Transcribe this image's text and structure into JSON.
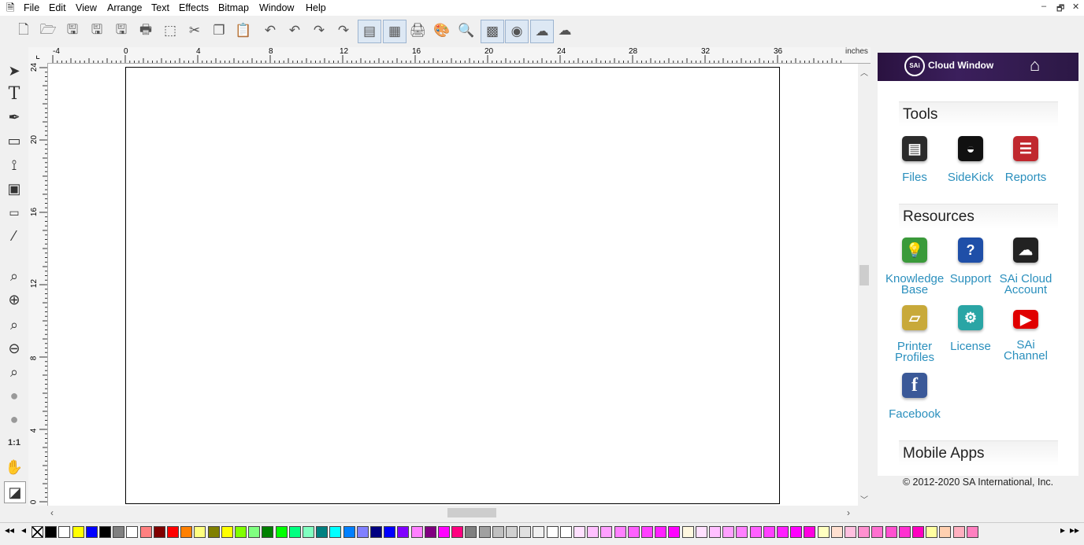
{
  "menu": [
    "File",
    "Edit",
    "View",
    "Arrange",
    "Text",
    "Effects",
    "Bitmap",
    "Window",
    "Help"
  ],
  "window_controls": [
    "–",
    "🗗",
    "✕"
  ],
  "ruler": {
    "unit": "inches",
    "h_ticks": [
      "-4",
      "0",
      "4",
      "8",
      "12",
      "16",
      "20",
      "24",
      "28",
      "32",
      "36"
    ],
    "v_ticks": [
      "24",
      "20",
      "16",
      "12",
      "8",
      "4",
      "0"
    ]
  },
  "cloud": {
    "title": "Cloud Window",
    "tools_title": "Tools",
    "tools": [
      {
        "label": "Files",
        "icon": "files-icon",
        "color": "#2b2b2b"
      },
      {
        "label": "SideKick",
        "icon": "sidekick-icon",
        "color": "#111111"
      },
      {
        "label": "Reports",
        "icon": "reports-icon",
        "color": "#c0282e"
      }
    ],
    "resources_title": "Resources",
    "resources": [
      {
        "label": "Knowledge Base",
        "icon": "knowledge-base-icon",
        "color": "#3a9a3a"
      },
      {
        "label": "Support",
        "icon": "support-icon",
        "color": "#1f4fa8"
      },
      {
        "label": "SAi Cloud Account",
        "icon": "cloud-account-icon",
        "color": "#222222"
      },
      {
        "label": "Printer Profiles",
        "icon": "printer-profiles-icon",
        "color": "#c8a93a"
      },
      {
        "label": "License",
        "icon": "license-icon",
        "color": "#2aa5a5"
      },
      {
        "label": "SAi Channel",
        "icon": "youtube-icon",
        "color": "#e00000"
      },
      {
        "label": "Facebook",
        "icon": "facebook-icon",
        "color": "#3b5998"
      }
    ],
    "mobile_title": "Mobile Apps",
    "copyright": "© 2012-2020 SA International, Inc."
  },
  "palette": [
    "#ffffff",
    "#000000",
    "#ffffff",
    "#ffff00",
    "#0000ff",
    "#000000",
    "#808080",
    "#ffffff",
    "#ff8080",
    "#800000",
    "#ff0000",
    "#ff8000",
    "#ffff80",
    "#808000",
    "#ffff00",
    "#80ff00",
    "#80ff80",
    "#008000",
    "#00ff00",
    "#00ff80",
    "#80ffc0",
    "#008080",
    "#00ffff",
    "#0080ff",
    "#8080ff",
    "#000080",
    "#0000ff",
    "#8000ff",
    "#ff80ff",
    "#800080",
    "#ff00ff",
    "#ff0080",
    "#808080",
    "#a0a0a0",
    "#c0c0c0",
    "#d0d0d0",
    "#e0e0e0",
    "#f0f0f0",
    "#ffffff",
    "#ffffff",
    "#ffe0ff",
    "#ffc0ff",
    "#ffa0ff",
    "#ff80ff",
    "#ff60ff",
    "#ff40ff",
    "#ff20ff",
    "#ff00ff",
    "#fff8e0",
    "#ffe0ff",
    "#ffc0ff",
    "#ffa0ff",
    "#ff80ff",
    "#ff60ff",
    "#ff40ff",
    "#ff20ff",
    "#ff00ff",
    "#ff00e0",
    "#ffffc0",
    "#ffe0d0",
    "#ffc0e0",
    "#ff90d0",
    "#ff70d0",
    "#ff50d0",
    "#ff30d0",
    "#ff00c0",
    "#ffffa0",
    "#ffd0b0",
    "#ffb0c0",
    "#ff80c0"
  ]
}
